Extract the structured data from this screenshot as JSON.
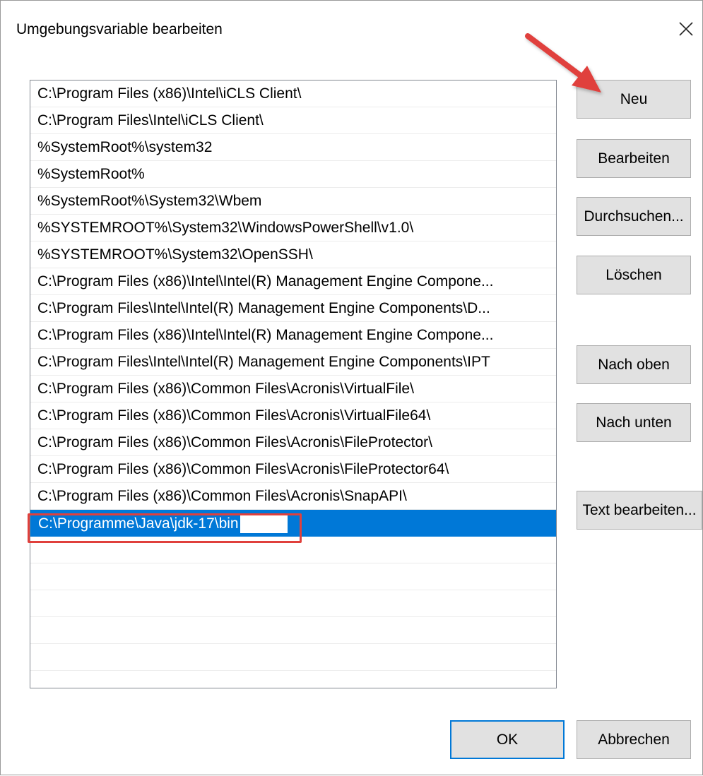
{
  "dialog": {
    "title": "Umgebungsvariable bearbeiten",
    "close_glyph": "✕"
  },
  "list": {
    "items": [
      "C:\\Program Files (x86)\\Intel\\iCLS Client\\",
      "C:\\Program Files\\Intel\\iCLS Client\\",
      "%SystemRoot%\\system32",
      "%SystemRoot%",
      "%SystemRoot%\\System32\\Wbem",
      "%SYSTEMROOT%\\System32\\WindowsPowerShell\\v1.0\\",
      "%SYSTEMROOT%\\System32\\OpenSSH\\",
      "C:\\Program Files (x86)\\Intel\\Intel(R) Management Engine Compone...",
      "C:\\Program Files\\Intel\\Intel(R) Management Engine Components\\D...",
      "C:\\Program Files (x86)\\Intel\\Intel(R) Management Engine Compone...",
      "C:\\Program Files\\Intel\\Intel(R) Management Engine Components\\IPT",
      "C:\\Program Files (x86)\\Common Files\\Acronis\\VirtualFile\\",
      "C:\\Program Files (x86)\\Common Files\\Acronis\\VirtualFile64\\",
      "C:\\Program Files (x86)\\Common Files\\Acronis\\FileProtector\\",
      "C:\\Program Files (x86)\\Common Files\\Acronis\\FileProtector64\\",
      "C:\\Program Files (x86)\\Common Files\\Acronis\\SnapAPI\\"
    ],
    "editing_value": "C:\\Programme\\Java\\jdk-17\\bin"
  },
  "buttons": {
    "new": "Neu",
    "edit": "Bearbeiten",
    "browse": "Durchsuchen...",
    "delete": "Löschen",
    "move_up": "Nach oben",
    "move_down": "Nach unten",
    "edit_text": "Text bearbeiten...",
    "ok": "OK",
    "cancel": "Abbrechen"
  },
  "colors": {
    "selection": "#0078d7",
    "annotation": "#e0403c"
  }
}
